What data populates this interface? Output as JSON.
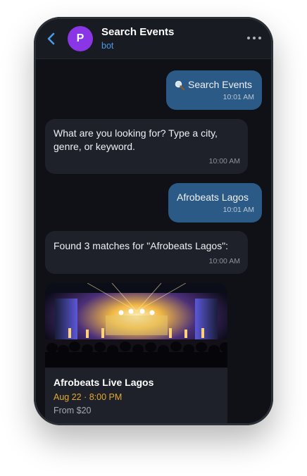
{
  "header": {
    "avatar_letter": "P",
    "title": "Search Events",
    "subtitle": "bot",
    "back_icon": "chevron-left-icon",
    "menu_icon": "more-horizontal-icon"
  },
  "messages": [
    {
      "from": "user",
      "icon": "magnifier-icon",
      "text": "Search Events",
      "time": "10:01 AM"
    },
    {
      "from": "bot",
      "text": "What are you looking for? Type a city, genre, or keyword.",
      "time": "10:00 AM"
    },
    {
      "from": "user",
      "text": "Afrobeats Lagos",
      "time": "10:01 AM"
    },
    {
      "from": "bot",
      "text": "Found 3 matches for \"Afrobeats Lagos\":",
      "time": "10:00 AM"
    }
  ],
  "event_card": {
    "title": "Afrobeats Live Lagos",
    "date": "Aug 22 · 8:00 PM",
    "price": "From $20",
    "image": "concert-stage-photo"
  },
  "colors": {
    "accent": "#4a9be8",
    "avatar": "#8b36e6",
    "outgoing_bubble": "#2b5a86",
    "incoming_bubble": "#1e2129",
    "date_highlight": "#e3a92d",
    "background": "#0f1116"
  }
}
